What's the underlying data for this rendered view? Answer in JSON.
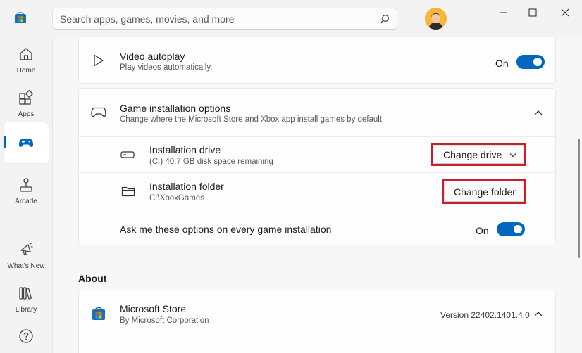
{
  "search": {
    "placeholder": "Search apps, games, movies, and more"
  },
  "nav": {
    "items": [
      {
        "label": "Home"
      },
      {
        "label": "Apps"
      },
      {
        "label": ""
      },
      {
        "label": "Arcade"
      },
      {
        "label": "What's New"
      },
      {
        "label": "Library"
      }
    ]
  },
  "settings": {
    "video": {
      "title": "Video autoplay",
      "subtitle": "Play videos automatically.",
      "toggle_label": "On"
    },
    "game_install": {
      "title": "Game installation options",
      "subtitle": "Change where the Microsoft Store and Xbox app install games by default",
      "drive": {
        "title": "Installation drive",
        "subtitle": "(C:) 40.7 GB disk space remaining",
        "button": "Change drive"
      },
      "folder": {
        "title": "Installation folder",
        "subtitle": "C:\\XboxGames",
        "button": "Change folder"
      },
      "ask": {
        "title": "Ask me these options on every game installation",
        "toggle_label": "On"
      }
    }
  },
  "about": {
    "heading": "About",
    "app_name": "Microsoft Store",
    "publisher": "By Microsoft Corporation",
    "version": "Version 22402.1401.4.0"
  },
  "colors": {
    "accent": "#0067c0",
    "highlight": "#c8202a"
  }
}
